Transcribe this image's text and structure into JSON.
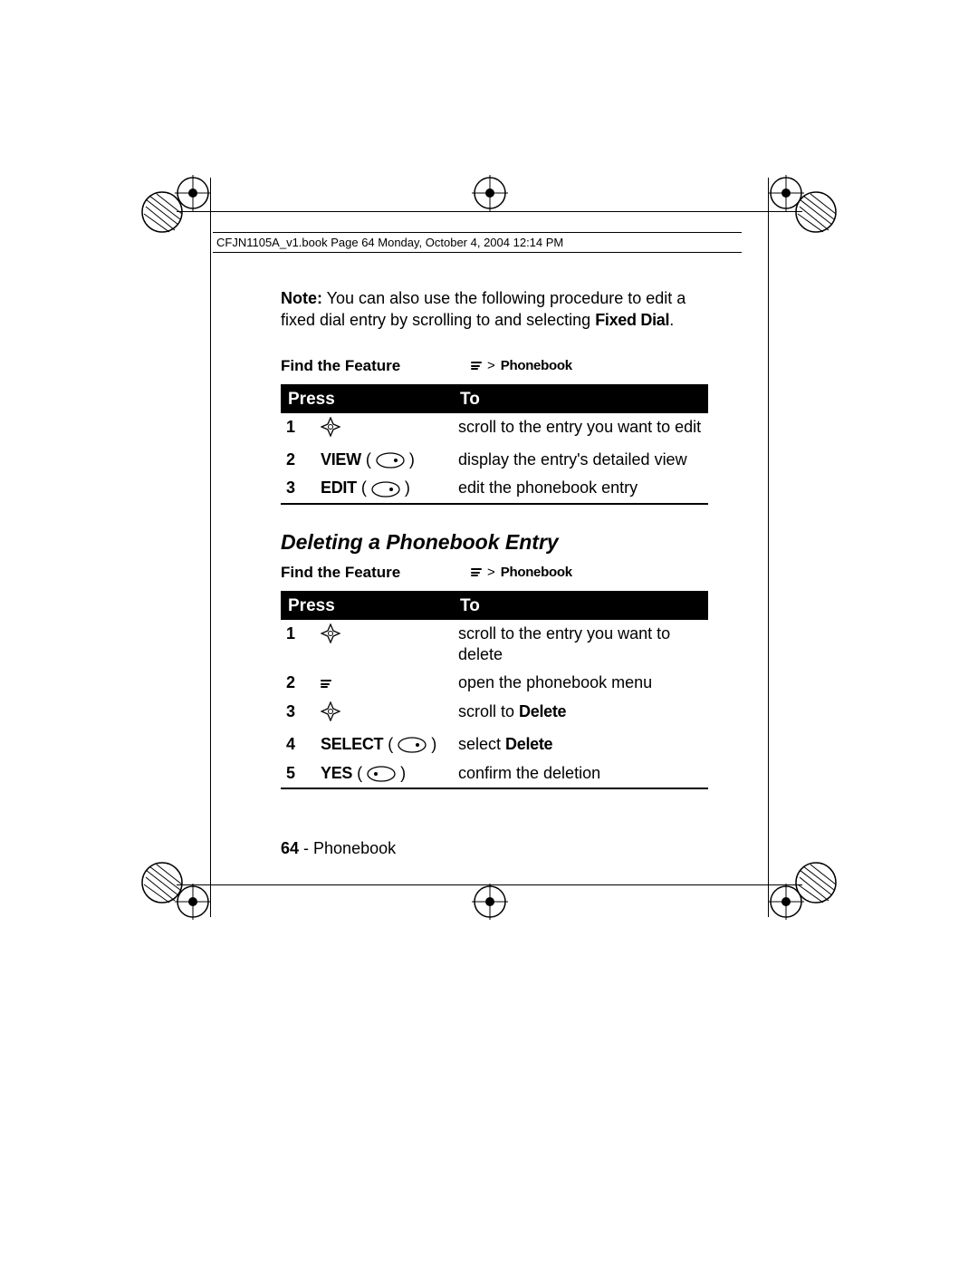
{
  "header": "CFJN1105A_v1.book  Page 64  Monday, October 4, 2004  12:14 PM",
  "note": {
    "label": "Note:",
    "text1": " You can also use the following procedure to edit a fixed dial entry by scrolling to and selecting ",
    "fixed_dial": "Fixed Dial",
    "period": "."
  },
  "find1": {
    "label": "Find the Feature",
    "sep": ">",
    "path": "Phonebook"
  },
  "table1": {
    "head_press": "Press",
    "head_to": "To",
    "rows": [
      {
        "num": "1",
        "press_icon": "nav",
        "press_label": "",
        "to": "scroll to the entry you want to edit"
      },
      {
        "num": "2",
        "press_icon": "right",
        "press_label": "VIEW",
        "to": "display the entry's detailed view"
      },
      {
        "num": "3",
        "press_icon": "right",
        "press_label": "EDIT",
        "to": "edit the phonebook entry"
      }
    ]
  },
  "heading2": "Deleting a Phonebook Entry",
  "find2": {
    "label": "Find the Feature",
    "sep": ">",
    "path": "Phonebook"
  },
  "table2": {
    "head_press": "Press",
    "head_to": "To",
    "rows": [
      {
        "num": "1",
        "press_icon": "nav",
        "press_label": "",
        "to_pre": "scroll to the entry you want to delete",
        "to_bold": ""
      },
      {
        "num": "2",
        "press_icon": "menu",
        "press_label": "",
        "to_pre": "open the phonebook menu",
        "to_bold": ""
      },
      {
        "num": "3",
        "press_icon": "nav",
        "press_label": "",
        "to_pre": "scroll to ",
        "to_bold": "Delete"
      },
      {
        "num": "4",
        "press_icon": "right",
        "press_label": "SELECT",
        "to_pre": "select ",
        "to_bold": "Delete"
      },
      {
        "num": "5",
        "press_icon": "left",
        "press_label": "YES",
        "to_pre": "confirm the deletion",
        "to_bold": ""
      }
    ]
  },
  "footer": {
    "page": "64",
    "sep": " - ",
    "section": "Phonebook"
  }
}
